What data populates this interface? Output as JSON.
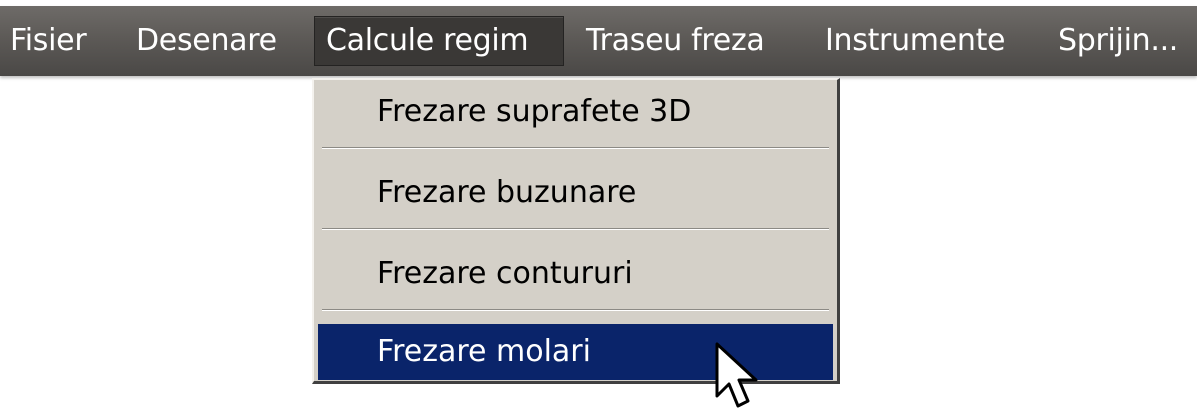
{
  "menubar": {
    "items": [
      {
        "label": "Fisier"
      },
      {
        "label": "Desenare"
      },
      {
        "label": "Calcule regim",
        "state": "open"
      },
      {
        "label": "Traseu freza"
      },
      {
        "label": "Instrumente"
      },
      {
        "label": "Sprijin..."
      }
    ]
  },
  "dropdown": {
    "items": [
      {
        "label": "Frezare suprafete 3D"
      },
      {
        "label": "Frezare buzunare"
      },
      {
        "label": "Frezare contururi"
      },
      {
        "label": "Frezare molari",
        "state": "highlighted"
      }
    ]
  },
  "cursor": {
    "icon": "arrow-pointer-icon"
  },
  "colors": {
    "menubar": "#5d5a57",
    "menu_text": "#ffffff",
    "active_menu": "#3a3836",
    "dropdown_bg": "#d4d0c8",
    "highlight": "#0a246a"
  }
}
